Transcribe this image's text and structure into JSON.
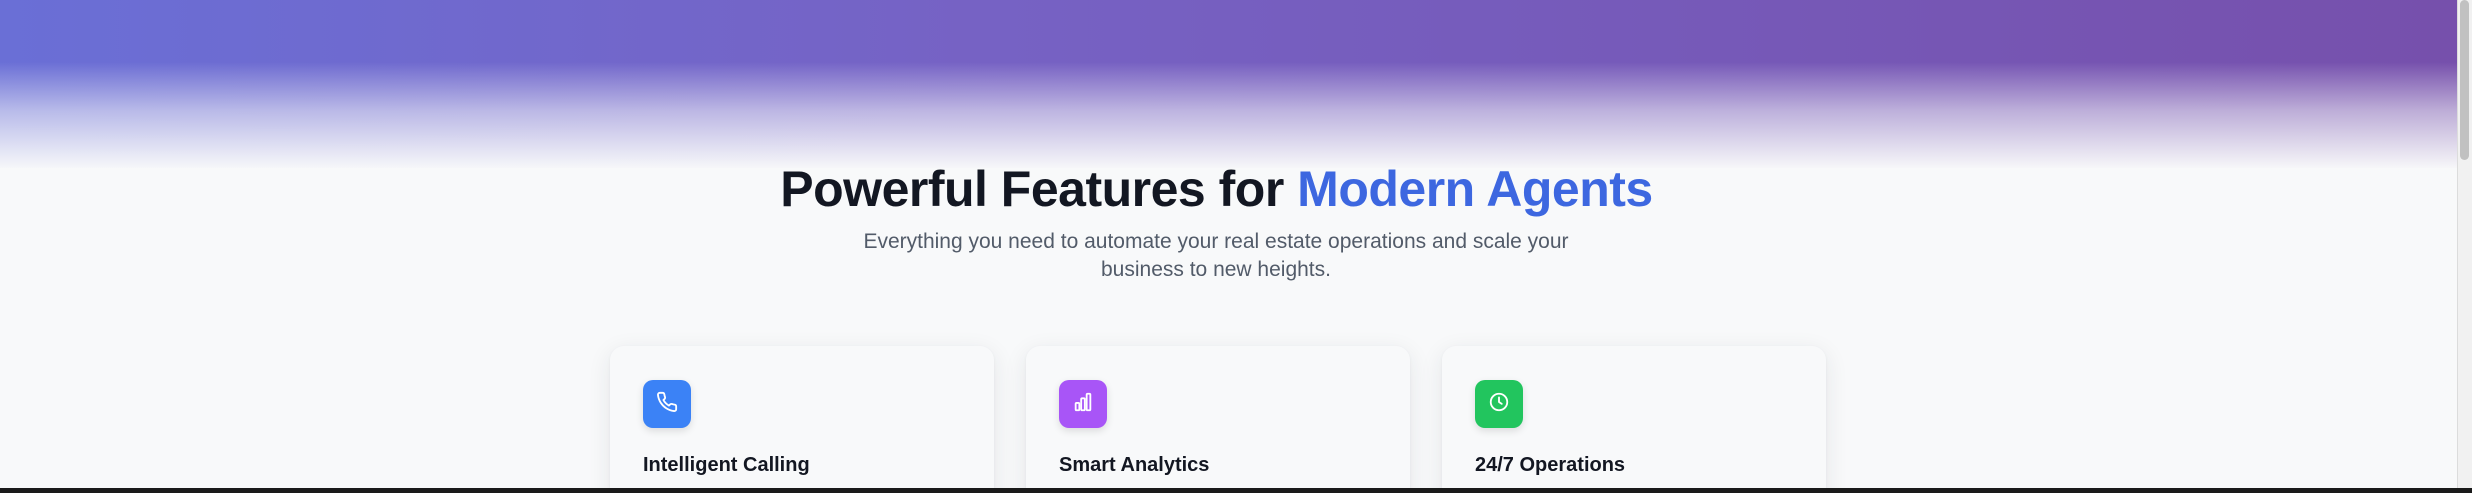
{
  "hero": {
    "gradient_colors": [
      "#6a6fd6",
      "#7662c4",
      "#7650ac"
    ]
  },
  "features_section": {
    "heading_part1": "Powerful Features for ",
    "heading_accent": "Modern Agents",
    "accent_color": "#3d67e0",
    "subtitle": "Everything you need to automate your real estate operations and scale your business to new heights.",
    "cards": [
      {
        "icon": "phone-icon",
        "icon_color": "#3b82f6",
        "title": "Intelligent Calling"
      },
      {
        "icon": "bar-chart-icon",
        "icon_color": "#a855f7",
        "title": "Smart Analytics"
      },
      {
        "icon": "clock-icon",
        "icon_color": "#22c55e",
        "title": "24/7 Operations"
      }
    ]
  }
}
